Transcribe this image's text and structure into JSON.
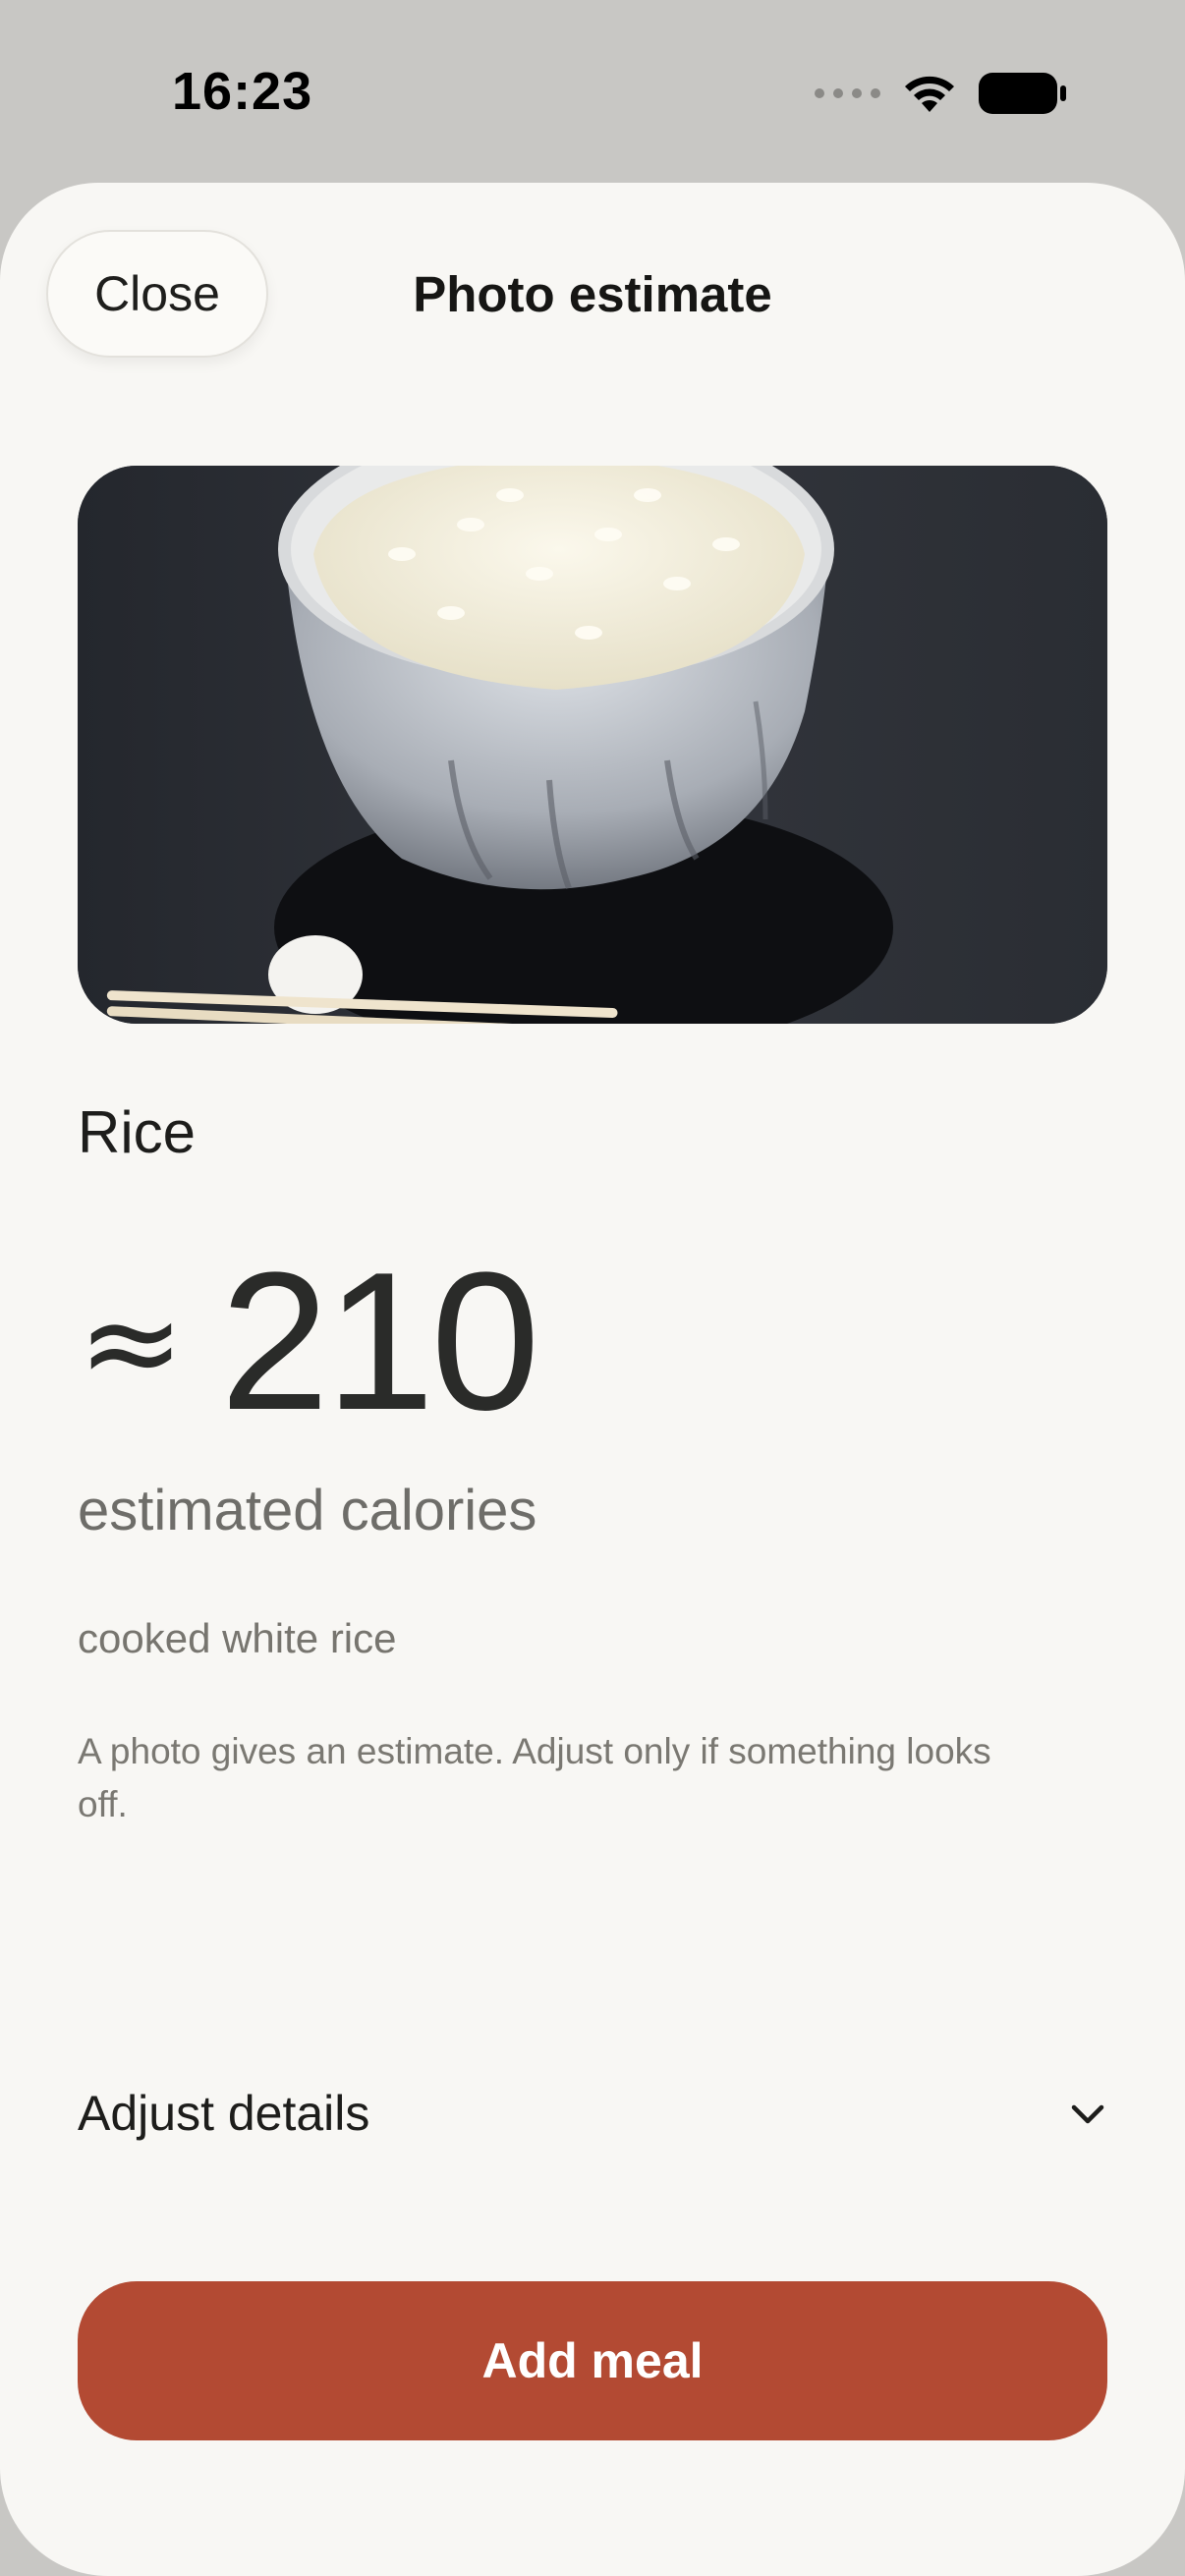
{
  "status_bar": {
    "time": "16:23",
    "icons": [
      "cellular-signal-icon",
      "wifi-icon",
      "battery-icon"
    ]
  },
  "sheet": {
    "title": "Photo estimate",
    "close_label": "Close"
  },
  "photo": {
    "subject": "bowl-of-rice-photo"
  },
  "estimate": {
    "food_name": "Rice",
    "approx_symbol": "≈",
    "calories": "210",
    "calories_label": "estimated calories",
    "description": "cooked white rice",
    "note": "A photo gives an estimate. Adjust only if something looks off."
  },
  "adjust": {
    "label": "Adjust details",
    "icon": "chevron-down-icon"
  },
  "actions": {
    "add_label": "Add meal"
  },
  "colors": {
    "accent": "#b34a33",
    "sheet_background": "#f8f7f4",
    "backdrop": "#c8c7c4"
  }
}
